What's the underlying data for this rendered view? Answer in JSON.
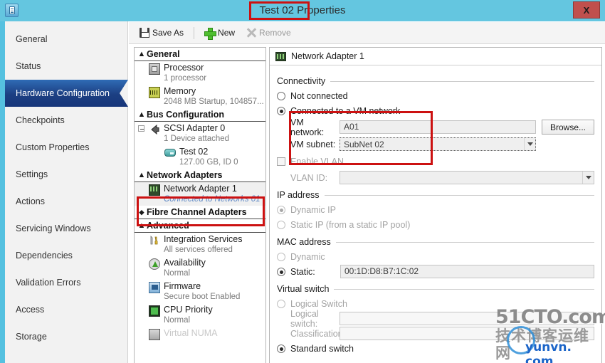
{
  "window": {
    "title": "Test 02 Properties",
    "icon": "vm-properties-icon",
    "close_label": "X"
  },
  "sidebar": {
    "items": [
      {
        "label": "General",
        "selected": false
      },
      {
        "label": "Status",
        "selected": false
      },
      {
        "label": "Hardware Configuration",
        "selected": true
      },
      {
        "label": "Checkpoints",
        "selected": false
      },
      {
        "label": "Custom Properties",
        "selected": false
      },
      {
        "label": "Settings",
        "selected": false
      },
      {
        "label": "Actions",
        "selected": false
      },
      {
        "label": "Servicing Windows",
        "selected": false
      },
      {
        "label": "Dependencies",
        "selected": false
      },
      {
        "label": "Validation Errors",
        "selected": false
      },
      {
        "label": "Access",
        "selected": false
      },
      {
        "label": "Storage",
        "selected": false
      }
    ]
  },
  "toolbar": {
    "save_as": "Save As",
    "new": "New",
    "remove": "Remove"
  },
  "tree": {
    "sections": [
      {
        "title": "General",
        "chevron": "expanded"
      },
      {
        "title": "Bus Configuration",
        "chevron": "expanded"
      },
      {
        "title": "Network Adapters",
        "chevron": "expanded"
      },
      {
        "title": "Fibre Channel Adapters",
        "chevron": "collapsed"
      },
      {
        "title": "Advanced",
        "chevron": "expanded"
      }
    ],
    "general": [
      {
        "label": "Processor",
        "sub": "1 processor",
        "icon": "cpu-icon"
      },
      {
        "label": "Memory",
        "sub": "2048 MB Startup, 104857...",
        "icon": "memory-icon"
      }
    ],
    "bus": [
      {
        "label": "SCSI Adapter 0",
        "sub": "1 Device attached",
        "icon": "scsi-adapter-icon"
      },
      {
        "label": "Test 02",
        "sub": "127.00 GB, ID 0",
        "icon": "virtual-disk-icon"
      }
    ],
    "network": [
      {
        "label": "Network Adapter 1",
        "sub": "Connected to Networks 01",
        "icon": "network-adapter-icon",
        "selected": true
      }
    ],
    "advanced": [
      {
        "label": "Integration Services",
        "sub": "All services offered",
        "icon": "integration-services-icon"
      },
      {
        "label": "Availability",
        "sub": "Normal",
        "icon": "availability-icon"
      },
      {
        "label": "Firmware",
        "sub": "Secure boot Enabled",
        "icon": "firmware-icon"
      },
      {
        "label": "CPU Priority",
        "sub": "Normal",
        "icon": "cpu-priority-icon"
      },
      {
        "label": "Virtual NUMA",
        "sub": "",
        "icon": "virtual-numa-icon"
      }
    ]
  },
  "detail": {
    "header": "Network Adapter 1",
    "connectivity": {
      "group": "Connectivity",
      "not_connected": "Not connected",
      "connected": "Connected to a VM network",
      "vm_network_label": "VM network:",
      "vm_network_value": "A01",
      "browse": "Browse...",
      "vm_subnet_label": "VM subnet:",
      "vm_subnet_value": "SubNet 02",
      "enable_vlan": "Enable VLAN",
      "vlan_id_label": "VLAN ID:",
      "vlan_id_value": ""
    },
    "ip": {
      "group": "IP address",
      "dynamic": "Dynamic IP",
      "static": "Static IP (from a static IP pool)"
    },
    "mac": {
      "group": "MAC address",
      "dynamic": "Dynamic",
      "static_label": "Static:",
      "static_value": "00:1D:D8:B7:1C:02"
    },
    "vswitch": {
      "group": "Virtual switch",
      "logical_switch_radio": "Logical Switch",
      "logical_switch_label": "Logical switch:",
      "logical_switch_value": "",
      "classification_label": "Classification:",
      "classification_value": "",
      "standard_switch": "Standard switch"
    }
  },
  "watermark": {
    "line1": "51CTO.com",
    "line2": "技术博客运维网",
    "line3": "yunvn. com"
  },
  "colors": {
    "titlebar": "#64c6e0",
    "accent_bar": "#55c1e0",
    "selected_nav": "#1c3f82",
    "annotation": "#cc1111",
    "close_button": "#c0504d",
    "link_text": "#5b86c4"
  }
}
